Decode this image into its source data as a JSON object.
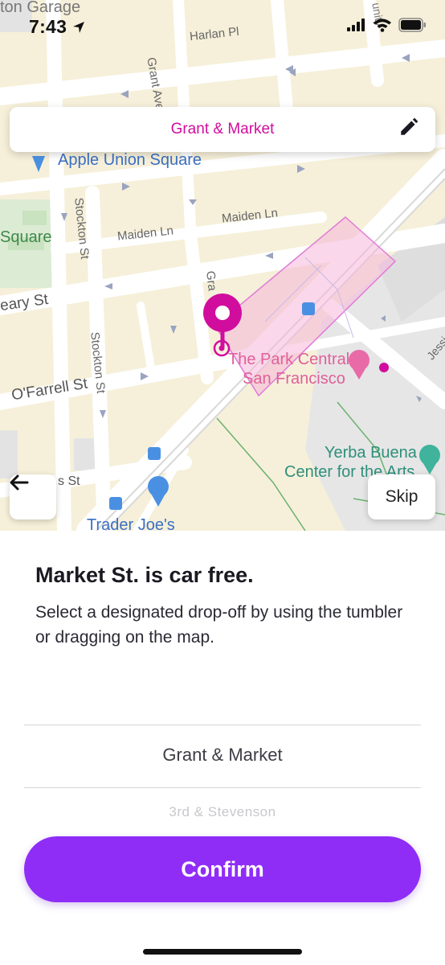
{
  "status_bar": {
    "time": "7:43",
    "location_icon": "location-arrow-icon",
    "signal_icon": "cellular-signal-icon",
    "wifi_icon": "wifi-icon",
    "battery_icon": "battery-icon"
  },
  "search": {
    "location": "Grant & Market",
    "edit_icon": "pencil-icon",
    "accent_color": "#d10d9e"
  },
  "map": {
    "labels": {
      "union_square_garage": "ton Garage",
      "harlan_pl": "Harlan Pl",
      "grant_ave_top": "Grant Ave",
      "unity": "unity",
      "apple_union_square": "Apple Union Square",
      "stockton_st_upper": "Stockton St",
      "union_square": "Square",
      "maiden_ln_left": "Maiden Ln",
      "maiden_ln_right": "Maiden Ln",
      "geary_st": "eary St",
      "grant_ave_mid": "Gra",
      "stockton_st_lower": "Stockton St",
      "ofarrell_st": "O'Farrell St",
      "park_central_1": "The Park Central",
      "park_central_2": "San Francisco",
      "jessie": "Jessie",
      "yerba_buena_1": "Yerba Buena",
      "yerba_buena_2": "Center for the Arts",
      "ellis_st": "s St",
      "trader_joes": "Trader Joe's"
    },
    "pin_color": "#d10d9e",
    "zone_color": "#f0a8e8"
  },
  "buttons": {
    "back_icon": "arrow-left-icon",
    "skip": "Skip",
    "confirm": "Confirm",
    "confirm_color": "#8f2df7"
  },
  "sheet": {
    "title": "Market St. is car free.",
    "description": "Select a designated drop-off by using the tumbler or dragging on the map.",
    "picker": {
      "selected": "Grant & Market",
      "next": "3rd & Stevenson"
    }
  }
}
